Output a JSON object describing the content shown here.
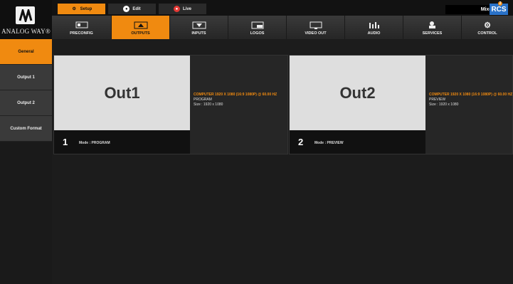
{
  "brand": {
    "logo_text": "ANALOG WAY®"
  },
  "modes": [
    {
      "label": "Setup",
      "icon": "gear-icon"
    },
    {
      "label": "Edit",
      "icon": "edit-icon"
    },
    {
      "label": "Live",
      "icon": "live-icon"
    }
  ],
  "topbar": {
    "mixer_label": "Mixer",
    "rcs_label": "RCS",
    "rcs_badge": "2"
  },
  "tabs": [
    {
      "label": "PRECONFIG",
      "icon": "preconfig-icon"
    },
    {
      "label": "OUTPUTS",
      "icon": "outputs-icon"
    },
    {
      "label": "INPUTS",
      "icon": "inputs-icon"
    },
    {
      "label": "LOGOS",
      "icon": "logos-icon"
    },
    {
      "label": "VIDEO OUT",
      "icon": "video-out-icon"
    },
    {
      "label": "AUDIO",
      "icon": "audio-icon"
    },
    {
      "label": "SERVICES",
      "icon": "services-icon"
    },
    {
      "label": "CONTROL",
      "icon": "control-icon"
    }
  ],
  "active_tab": "OUTPUTS",
  "sidebar": {
    "items": [
      {
        "label": "General",
        "active": true
      },
      {
        "label": "Output 1",
        "active": false
      },
      {
        "label": "Output 2",
        "active": false
      },
      {
        "label": "Custom Format",
        "active": false
      }
    ]
  },
  "outputs": [
    {
      "title": "Out1",
      "number": "1",
      "mode": "Mode : PROGRAM",
      "resolution": "COMPUTER 1920 X 1080 (16:9 1080P) @ 60.00 HZ",
      "type": "PROGRAM",
      "size": "Size : 1920 x 1080"
    },
    {
      "title": "Out2",
      "number": "2",
      "mode": "Mode : PREVIEW",
      "resolution": "COMPUTER 1920 X 1080 (16:9 1080P) @ 60.00 HZ",
      "type": "PREVIEW",
      "size": "Size : 1920 x 1080"
    }
  ],
  "colors": {
    "accent": "#f08a10",
    "background": "#1c1c1c",
    "rcs_blue": "#2a72c8",
    "live_red": "#e53935"
  }
}
